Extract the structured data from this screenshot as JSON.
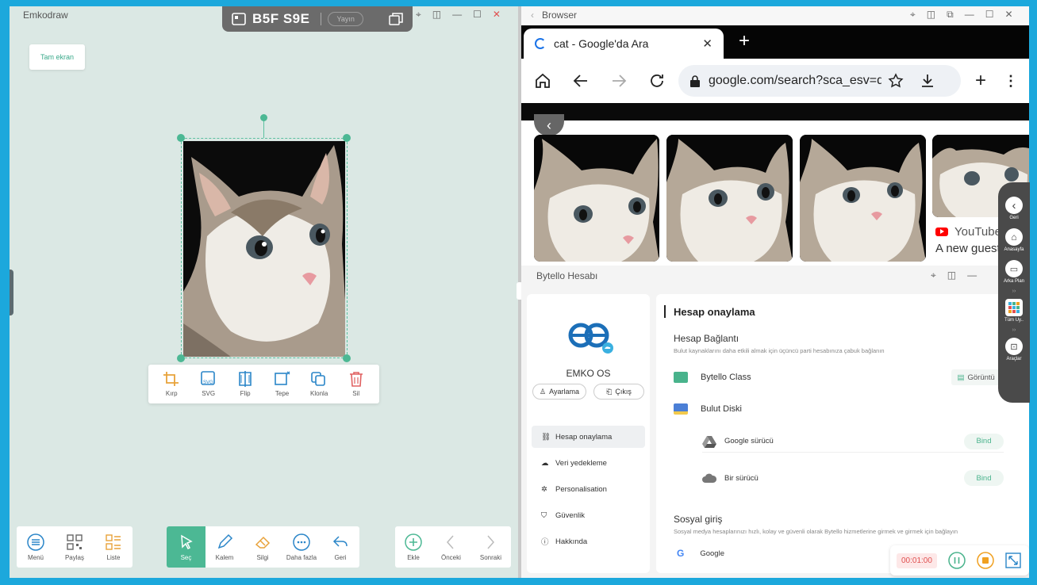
{
  "left_window": {
    "title": "Emkodraw",
    "fullscreen_btn": "Tam ekran",
    "room_code": "B5F S9E",
    "publish_btn": "Yayın",
    "image_toolbar": [
      {
        "icon": "crop-icon",
        "label": "Kırp"
      },
      {
        "icon": "svg-icon",
        "label": "SVG"
      },
      {
        "icon": "flip-icon",
        "label": "Flip"
      },
      {
        "icon": "top-icon",
        "label": "Tepe"
      },
      {
        "icon": "clone-icon",
        "label": "Klonla"
      },
      {
        "icon": "trash-icon",
        "label": "Sil"
      }
    ],
    "bottom_left": [
      {
        "icon": "menu-icon",
        "label": "Menü"
      },
      {
        "icon": "qr-icon",
        "label": "Paylaş"
      },
      {
        "icon": "list-icon",
        "label": "Liste"
      }
    ],
    "bottom_center": [
      {
        "icon": "cursor-icon",
        "label": "Seç",
        "active": true
      },
      {
        "icon": "pen-icon",
        "label": "Kalem"
      },
      {
        "icon": "eraser-icon",
        "label": "Silgi"
      },
      {
        "icon": "more-icon",
        "label": "Daha fazla"
      },
      {
        "icon": "undo-icon",
        "label": "Geri"
      }
    ],
    "bottom_right": [
      {
        "icon": "add-icon",
        "label": "Ekle"
      },
      {
        "icon": "prev-icon",
        "label": "Önceki"
      },
      {
        "icon": "next-icon",
        "label": "Sonraki"
      }
    ]
  },
  "browser": {
    "title": "Browser",
    "tab_title": "cat - Google'da Ara",
    "url": "google.com/search?sca_esv=dc",
    "result_caption_source": "YouTube",
    "result_caption_text": "A new guest has"
  },
  "account_window": {
    "title": "Bytello Hesabı",
    "brand_name": "EMKO OS",
    "settings_btn": "Ayarlama",
    "logout_btn": "Çıkış",
    "nav": [
      {
        "icon": "link-icon",
        "label": "Hesap onaylama",
        "active": true
      },
      {
        "icon": "cloud-upload-icon",
        "label": "Veri yedekleme"
      },
      {
        "icon": "personalize-icon",
        "label": "Personalisation"
      },
      {
        "icon": "shield-icon",
        "label": "Güvenlik"
      },
      {
        "icon": "info-icon",
        "label": "Hakkında"
      }
    ],
    "heading": "Hesap onaylama",
    "section_title": "Hesap Bağlantı",
    "section_desc": "Bulut kaynaklarını daha etkili almak için üçüncü parti hesabınıza çabuk bağlanın",
    "class_label": "Bytello Class",
    "class_action": "Görüntü",
    "cloud_label": "Bulut Diski",
    "google_drive": "Google sürücü",
    "one_drive": "Bir sürücü",
    "bind_label": "Bind",
    "social_title": "Sosyal giriş",
    "social_desc": "Sosyal medya hesaplarınızı hızlı, kolay ve güvenli olarak Bytello hizmetlerine girmek ve girmek için bağlayın",
    "google_label": "Google"
  },
  "side_dock": [
    {
      "icon": "back-icon",
      "label": "Geri"
    },
    {
      "icon": "home-icon",
      "label": "Anasayfa"
    },
    {
      "icon": "background-icon",
      "label": "Arka Plan"
    },
    {
      "icon": "apps-icon",
      "label": "Tüm Uy.."
    },
    {
      "icon": "tools-icon",
      "label": "Araçlar"
    }
  ],
  "recorder": {
    "time": "00:01:00"
  }
}
